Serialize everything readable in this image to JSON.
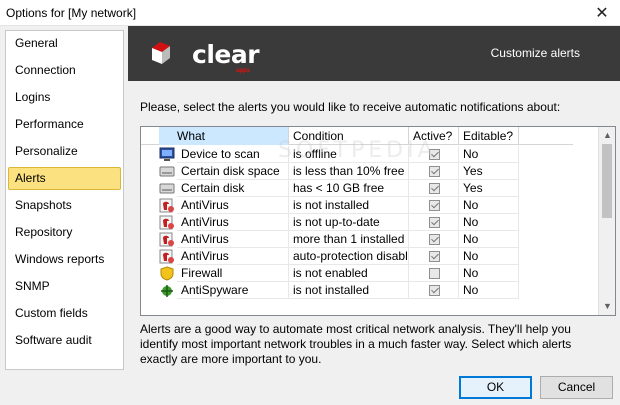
{
  "window": {
    "title": "Options for [My network]",
    "close_glyph": "✕"
  },
  "sidebar": {
    "items": [
      {
        "label": "General",
        "active": false
      },
      {
        "label": "Connection",
        "active": false
      },
      {
        "label": "Logins",
        "active": false
      },
      {
        "label": "Performance",
        "active": false
      },
      {
        "label": "Personalize",
        "active": false
      },
      {
        "label": "Alerts",
        "active": true
      },
      {
        "label": "Snapshots",
        "active": false
      },
      {
        "label": "Repository",
        "active": false
      },
      {
        "label": "Windows reports",
        "active": false
      },
      {
        "label": "SNMP",
        "active": false
      },
      {
        "label": "Custom fields",
        "active": false
      },
      {
        "label": "Software audit",
        "active": false
      }
    ]
  },
  "banner": {
    "logo_text": "clear",
    "logo_sub": "apps",
    "heading": "Customize alerts",
    "background": "#3a3a3a",
    "logo_accent": "#d11111"
  },
  "alerts": {
    "prompt": "Please, select the alerts you would like to receive automatic notifications about:",
    "columns": [
      "What",
      "Condition",
      "Active?",
      "Editable?"
    ],
    "rows": [
      {
        "icon": "monitor-icon",
        "what": "Device to scan",
        "condition": "is offline",
        "active": true,
        "editable": "No"
      },
      {
        "icon": "disk-icon",
        "what": "Certain disk space",
        "condition": "is less than 10% free",
        "active": true,
        "editable": "Yes"
      },
      {
        "icon": "disk-icon",
        "what": "Certain disk",
        "condition": "has <  10 GB free",
        "active": true,
        "editable": "Yes"
      },
      {
        "icon": "antivirus-icon",
        "what": "AntiVirus",
        "condition": "is not installed",
        "active": true,
        "editable": "No"
      },
      {
        "icon": "antivirus-icon",
        "what": "AntiVirus",
        "condition": "is not up-to-date",
        "active": true,
        "editable": "No"
      },
      {
        "icon": "antivirus-icon",
        "what": "AntiVirus",
        "condition": "more than 1 installed",
        "active": true,
        "editable": "No"
      },
      {
        "icon": "antivirus-icon",
        "what": "AntiVirus",
        "condition": "auto-protection disabled",
        "active": true,
        "editable": "No"
      },
      {
        "icon": "firewall-icon",
        "what": "Firewall",
        "condition": "is not enabled",
        "active": false,
        "editable": "No"
      },
      {
        "icon": "antispyware-icon",
        "what": "AntiSpyware",
        "condition": "is not installed",
        "active": true,
        "editable": "No"
      }
    ],
    "description": "Alerts are a good way to automate most critical network analysis. They'll help you identify most important network troubles in a much faster way. Select which alerts exactly are more important to you."
  },
  "watermark": "SOFTPEDIA",
  "footer": {
    "ok_label": "OK",
    "cancel_label": "Cancel"
  }
}
